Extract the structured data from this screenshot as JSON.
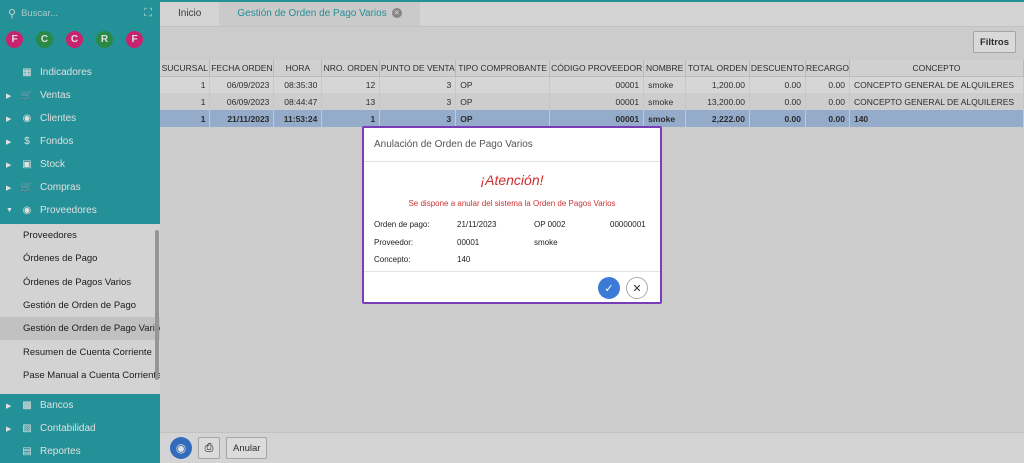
{
  "search": {
    "placeholder": "Buscar..."
  },
  "favorites": [
    {
      "letter": "F",
      "color": "#e4287e"
    },
    {
      "letter": "C",
      "color": "#2f9e53"
    },
    {
      "letter": "C",
      "color": "#e4287e"
    },
    {
      "letter": "R",
      "color": "#2f9e53"
    },
    {
      "letter": "F",
      "color": "#e4287e"
    }
  ],
  "sidebar": {
    "main_items": [
      "Indicadores",
      "Ventas",
      "Clientes",
      "Fondos",
      "Stock",
      "Compras",
      "Proveedores"
    ],
    "sub_items": [
      "Proveedores",
      "Órdenes de Pago",
      "Órdenes de Pagos Varios",
      "Gestión de Orden de Pago",
      "Gestión de Orden de Pago Varios",
      "Resumen de Cuenta Corriente",
      "Pase Manual a Cuenta Corriente"
    ],
    "bottom_items": [
      "Bancos",
      "Contabilidad",
      "Reportes"
    ]
  },
  "tabs": {
    "home": "Inicio",
    "active": "Gestión de Orden de Pago Varios"
  },
  "toolbar": {
    "filters_label": "Filtros",
    "cancel_label": "Anular"
  },
  "table": {
    "columns": [
      "SUCURSAL",
      "FECHA ORDEN",
      "HORA",
      "NRO. ORDEN",
      "PUNTO DE VENTA",
      "TIPO COMPROBANTE",
      "CÓDIGO PROVEEDOR",
      "NOMBRE",
      "TOTAL ORDEN",
      "DESCUENTO",
      "RECARGO",
      "CONCEPTO"
    ],
    "rows": [
      [
        "1",
        "06/09/2023",
        "08:35:30",
        "12",
        "3",
        "OP",
        "00001",
        "smoke",
        "1,200.00",
        "0.00",
        "0.00",
        "CONCEPTO GENERAL DE ALQUILERES"
      ],
      [
        "1",
        "06/09/2023",
        "08:44:47",
        "13",
        "3",
        "OP",
        "00001",
        "smoke",
        "13,200.00",
        "0.00",
        "0.00",
        "CONCEPTO GENERAL DE ALQUILERES"
      ],
      [
        "1",
        "21/11/2023",
        "11:53:24",
        "1",
        "3",
        "OP",
        "00001",
        "smoke",
        "2,222.00",
        "0.00",
        "0.00",
        "140"
      ]
    ]
  },
  "modal": {
    "title": "Anulación de Orden de Pago Varios",
    "heading": "¡Atención!",
    "message": "Se dispone a anular del sistema la Orden de Pagos Varios",
    "order_label": "Orden de pago:",
    "order_date": "21/11/2023",
    "order_type": "OP 0002",
    "order_number": "00000001",
    "provider_label": "Proveedor:",
    "provider_code": "00001",
    "provider_name": "smoke",
    "concept_label": "Concepto:",
    "concept_value": "140"
  },
  "colors": {
    "sidebar": "#2aa5ad",
    "accent": "#3b7bd6",
    "modal_border": "#7a3db8",
    "warning": "#d12b2b"
  }
}
